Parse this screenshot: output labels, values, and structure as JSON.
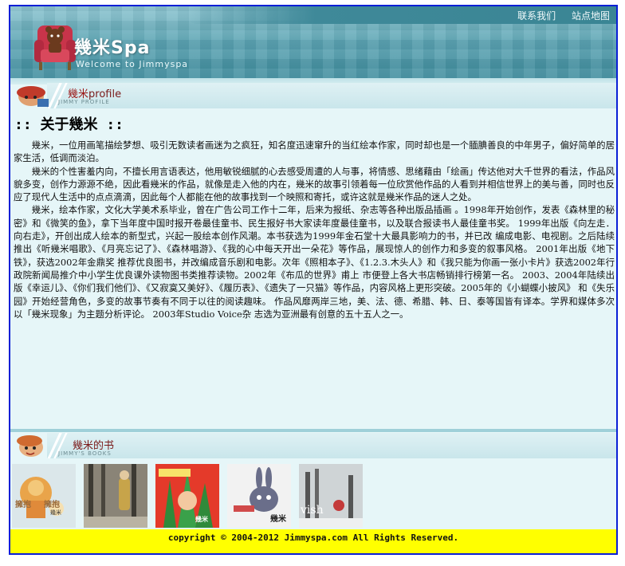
{
  "header": {
    "site_title": "幾米Spa",
    "site_subtitle": "Welcome to Jimmyspa",
    "links": [
      "联系我们",
      "站点地图"
    ]
  },
  "profile": {
    "section_title_cn": "幾米",
    "section_title_en": "profile",
    "section_sub": "JIMMY PROFILE",
    "heading": ":: 关于幾米 ::",
    "paragraphs": [
      "幾米，一位用画笔描绘梦想、吸引无数读者画迷为之疯狂，知名度迅速窜升的当红绘本作家，同时却也是一个腼腆善良的中年男子，偏好简单的居家生活，低调而淡泊。",
      "幾米的个性害羞内向，不擅长用言语表达，他用敏锐细腻的心去感受周遭的人与事，将情感、思绪藉由「绘画」传达他对大千世界的看法，作品风貌多变，创作力源源不绝，因此看幾米的作品，就像是走入他的内在，幾米的故事引领着每一位欣赏他作品的人看到并相信世界上的美与善，同时也反应了现代人生活中的点点滴滴，因此每个人都能在他的故事找到一个映照和寄托，或许这就是幾米作品的迷人之处。",
      "幾米，绘本作家，文化大学美术系毕业，曾在广告公司工作十二年，后来为报纸、杂志等各种出版品插画 。1998年开始创作，发表《森林里的秘密》和《微笑的鱼》，拿下当年度中国时报开卷最佳童书、民生报好书大家读年度最佳童书，以及联合报读书人最佳童书奖。 1999年出版《向左走．向右走》，开创出成人绘本的新型式，兴起一股绘本创作风潮。本书获选为1999年金石堂十大最具影响力的书，并已改 编成电影、电视剧。之后陆续推出《听幾米唱歌》、《月亮忘记了》、《森林唱游》、《我的心中每天开出一朵花》等作品，展现惊人的创作力和多变的叙事风格。 2001年出版《地下铁》，获选2002年金鼎奖 推荐优良图书，并改编成音乐剧和电影。次年《照相本子》、《1.2.3.木头人》和《我只能为你画一张小卡片》获选2002年行政院新闻局推介中小学生优良课外读物图书类推荐读物。2002年《布瓜的世界》甫上 市便登上各大书店畅销排行榜第一名。 2003、2004年陆续出版《幸运儿》、《你们我们他们》、《又寂寞又美好》、《履历表》、《遗失了一只猫》等作品，内容风格上更形突破。2005年的《小蝴蝶小披风》 和《失乐园》开始经营角色，多变的故事节奏有不同于以往的阅读趣味。 作品风靡两岸三地，美、法、德、希腊、韩、日、泰等国皆有译本。学界和媒体多次以「幾米现象」为主题分析评论。 2003年Studio Voice杂 志选为亚洲最有创意的五十五人之一。"
    ]
  },
  "books": {
    "section_title": "幾米的书",
    "section_sub": "JIMMY'S BOOKS",
    "covers": [
      {
        "caption": "擁抱",
        "caption2": "擁抱",
        "author": "幾米",
        "bg": "#dbe7ea"
      },
      {
        "caption": "",
        "author": "",
        "bg": "#8a8477"
      },
      {
        "caption": "",
        "author": "幾米",
        "bg": "#e43a2a"
      },
      {
        "caption": "",
        "author": "幾米",
        "bg": "#f2f2f2"
      },
      {
        "caption": "vish",
        "author": "",
        "bg": "#cfd4d6"
      }
    ]
  },
  "footer": {
    "text": "copyright © 2004-2012 Jimmyspa.com All Rights Reserved."
  }
}
